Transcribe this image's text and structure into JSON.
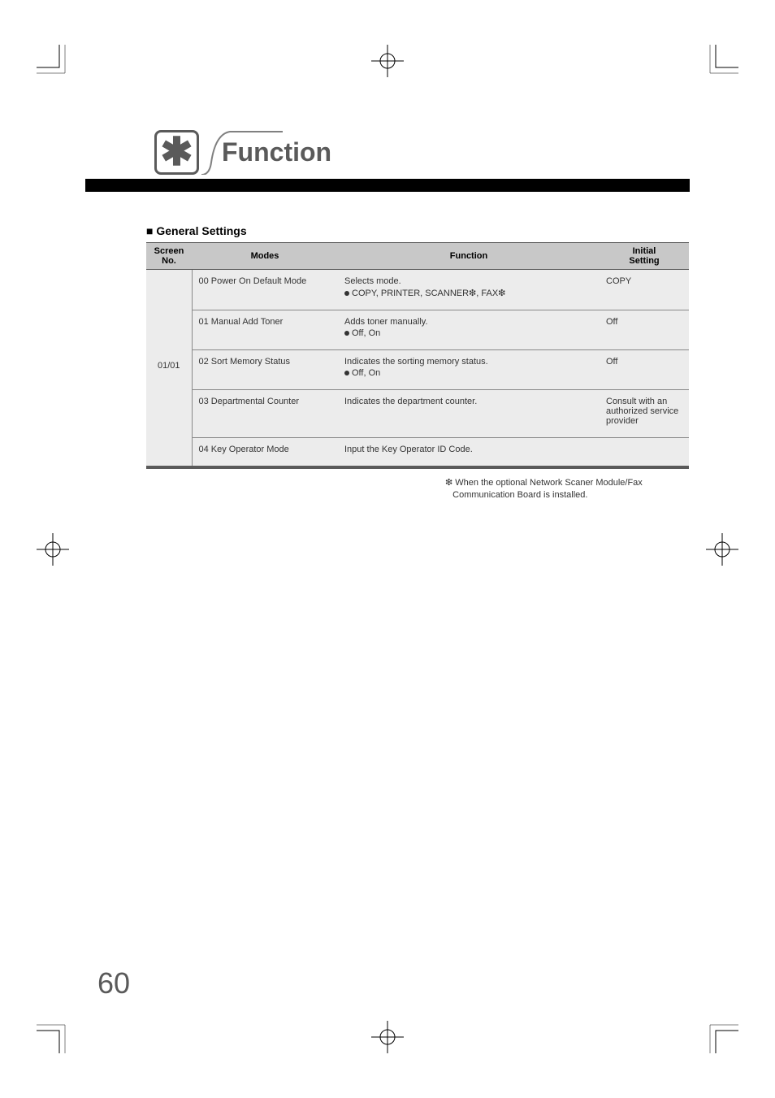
{
  "header": {
    "title": "Function",
    "icon_name": "asterisk"
  },
  "section_heading": "■ General Settings",
  "table": {
    "headers": {
      "col1_line1": "Screen",
      "col1_line2": "No.",
      "col2": "Modes",
      "col3": "Function",
      "col4_line1": "Initial",
      "col4_line2": "Setting"
    },
    "screen_no": "01/01",
    "rows": [
      {
        "mode": "00 Power On Default Mode",
        "function_line1": "Selects mode.",
        "function_line2": "COPY, PRINTER, SCANNER❇, FAX❇",
        "setting": "COPY"
      },
      {
        "mode": "01 Manual Add Toner",
        "function_line1": "Adds toner manually.",
        "function_line2": "Off, On",
        "setting": "Off"
      },
      {
        "mode": "02 Sort Memory Status",
        "function_line1": "Indicates the sorting memory status.",
        "function_line2": "Off, On",
        "setting": "Off"
      },
      {
        "mode": "03 Departmental Counter",
        "function_line1": "Indicates the department counter.",
        "function_line2": "",
        "setting": "Consult with an authorized service provider"
      },
      {
        "mode": "04 Key Operator Mode",
        "function_line1": "Input the Key Operator ID Code.",
        "function_line2": "",
        "setting": ""
      }
    ]
  },
  "footnote": {
    "mark": "❇",
    "line1": "When the optional Network Scaner Module/Fax",
    "line2": "Communication Board is installed."
  },
  "page_number": "60"
}
